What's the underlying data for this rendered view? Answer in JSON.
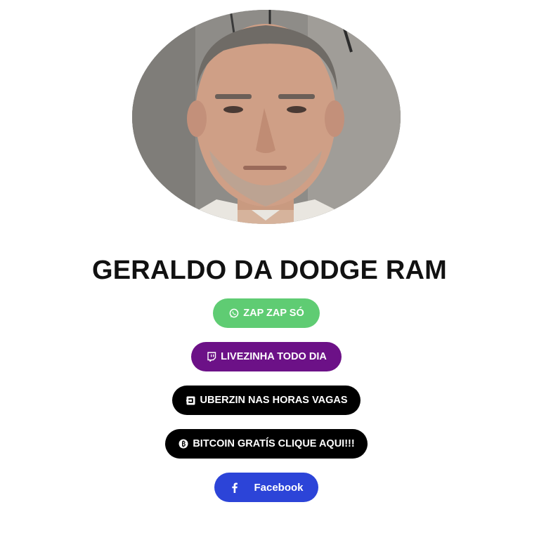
{
  "profile": {
    "name": "GERALDO DA DODGE RAM",
    "avatar_icon": "profile-photo"
  },
  "links": [
    {
      "label": "ZAP ZAP SÓ",
      "icon": "whatsapp-icon",
      "color": "#5fcc73"
    },
    {
      "label": "LIVEZINHA TODO DIA",
      "icon": "twitch-icon",
      "color": "#6c1187"
    },
    {
      "label": "UBERZIN NAS HORAS VAGAS",
      "icon": "uber-icon",
      "color": "#000000"
    },
    {
      "label": "BITCOIN GRATÍS CLIQUE AQUI!!!",
      "icon": "bitcoin-icon",
      "color": "#000000"
    },
    {
      "label": "Facebook",
      "icon": "facebook-icon",
      "color": "#2c44d8"
    }
  ]
}
